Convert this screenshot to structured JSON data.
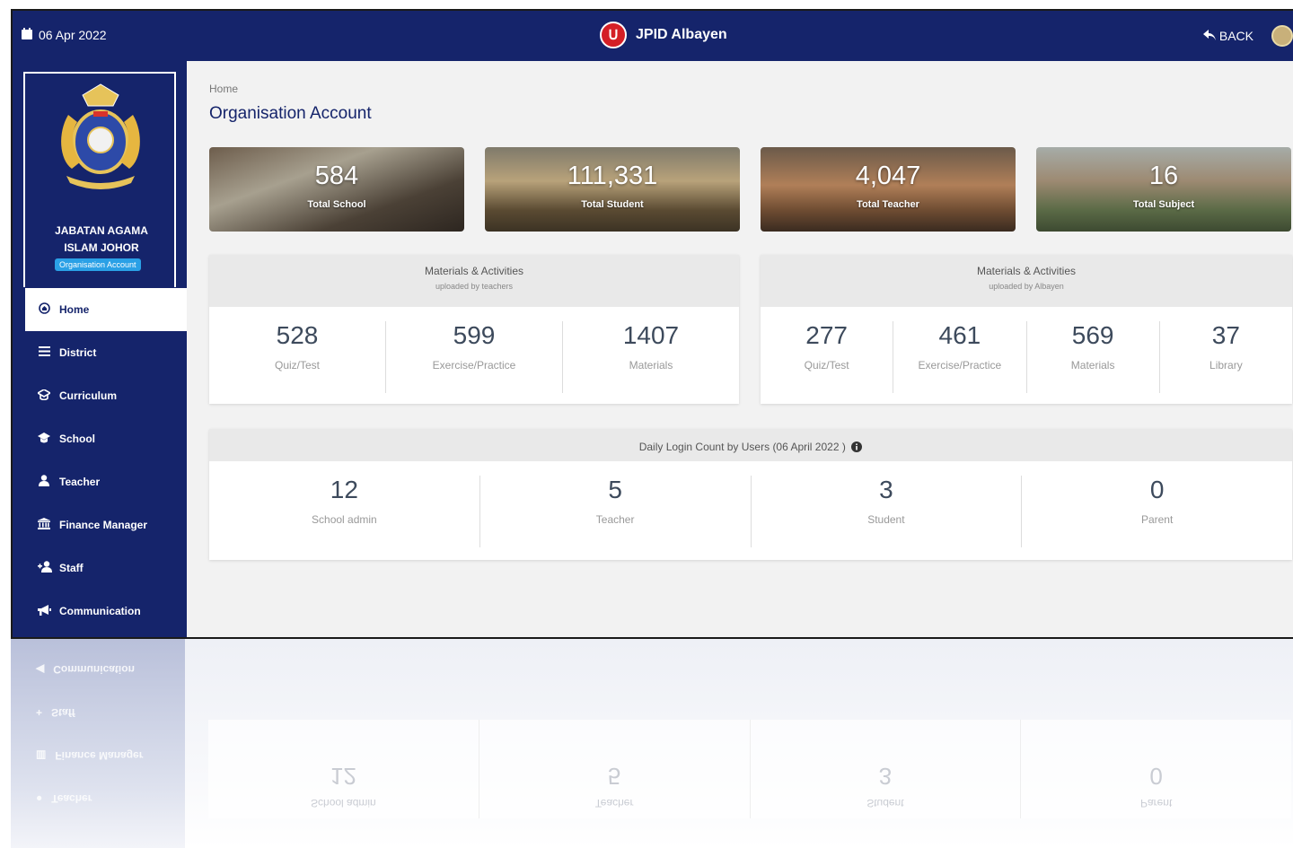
{
  "header": {
    "date": "06 Apr 2022",
    "brand": "JPID Albayen",
    "back_label": "BACK",
    "colors": {
      "bar": "#15246b",
      "logo_red": "#d41f26"
    }
  },
  "sidebar": {
    "org_line1": "JABATAN AGAMA",
    "org_line2": "ISLAM JOHOR",
    "org_badge": "Organisation Account",
    "items": [
      {
        "label": "Home",
        "icon": "home-icon"
      },
      {
        "label": "District",
        "icon": "list-icon"
      },
      {
        "label": "Curriculum",
        "icon": "graduation-icon"
      },
      {
        "label": "School",
        "icon": "school-icon"
      },
      {
        "label": "Teacher",
        "icon": "user-icon"
      },
      {
        "label": "Finance Manager",
        "icon": "bank-icon"
      },
      {
        "label": "Staff",
        "icon": "user-plus-icon"
      },
      {
        "label": "Communication",
        "icon": "megaphone-icon"
      }
    ]
  },
  "main": {
    "breadcrumb": "Home",
    "title": "Organisation Account",
    "stats": [
      {
        "value": "584",
        "label": "Total School"
      },
      {
        "value": "111,331",
        "label": "Total Student"
      },
      {
        "value": "4,047",
        "label": "Total Teacher"
      },
      {
        "value": "16",
        "label": "Total Subject"
      }
    ],
    "teachers_panel": {
      "title": "Materials & Activities",
      "subtitle": "uploaded by teachers",
      "cells": [
        {
          "value": "528",
          "label": "Quiz/Test"
        },
        {
          "value": "599",
          "label": "Exercise/Practice"
        },
        {
          "value": "1407",
          "label": "Materials"
        }
      ]
    },
    "albayen_panel": {
      "title": "Materials & Activities",
      "subtitle": "uploaded by Albayen",
      "cells": [
        {
          "value": "277",
          "label": "Quiz/Test"
        },
        {
          "value": "461",
          "label": "Exercise/Practice"
        },
        {
          "value": "569",
          "label": "Materials"
        },
        {
          "value": "37",
          "label": "Library"
        }
      ]
    },
    "login_panel": {
      "title": "Daily Login Count by Users (06 April 2022 )",
      "cells": [
        {
          "value": "12",
          "label": "School admin"
        },
        {
          "value": "5",
          "label": "Teacher"
        },
        {
          "value": "3",
          "label": "Student"
        },
        {
          "value": "0",
          "label": "Parent"
        }
      ]
    }
  }
}
